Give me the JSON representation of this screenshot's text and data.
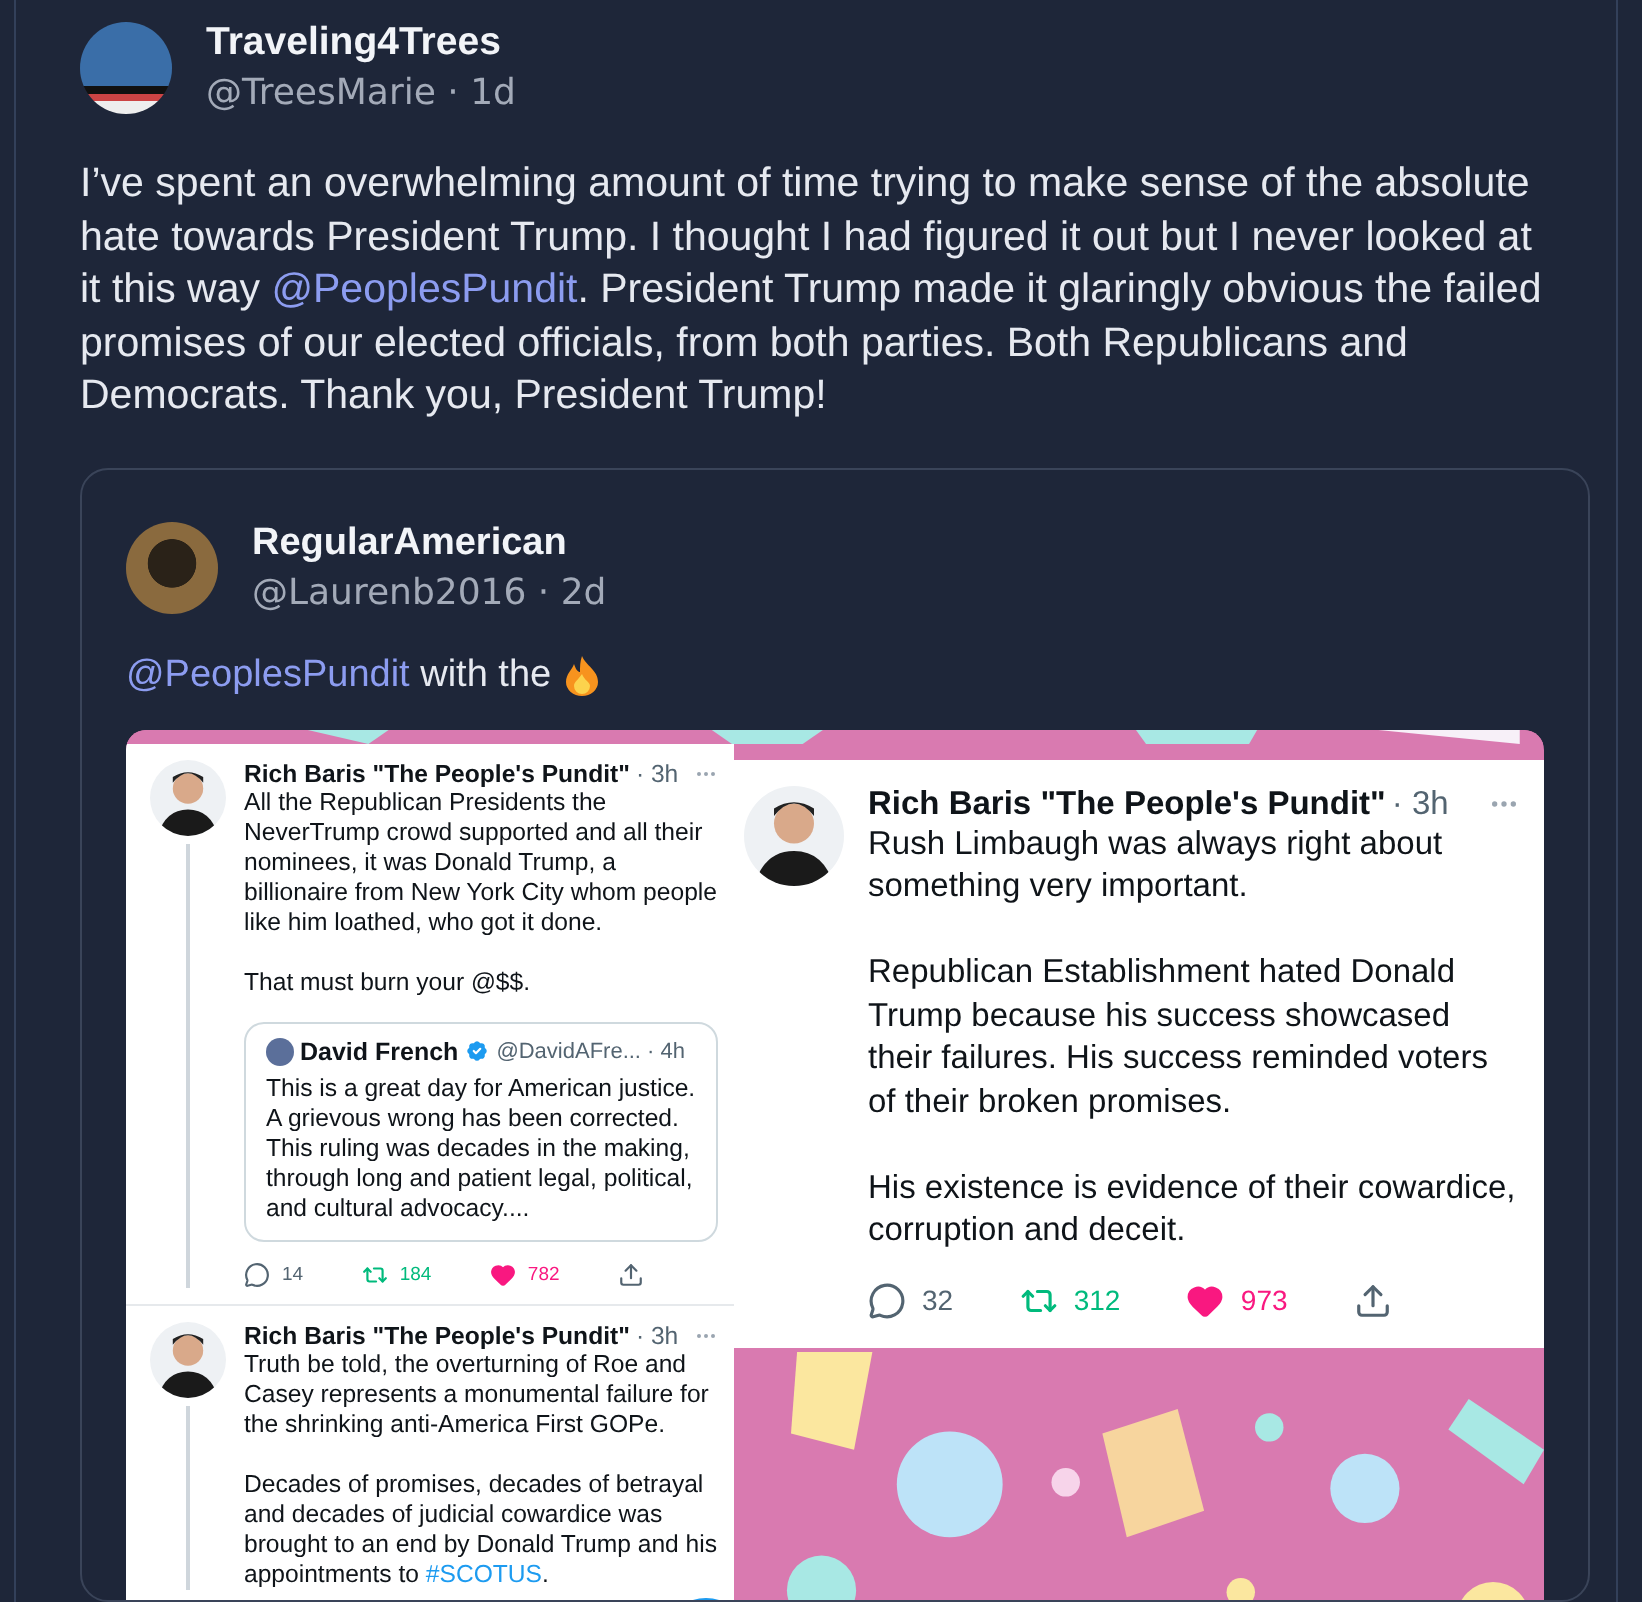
{
  "post": {
    "author": {
      "name": "Traveling4Trees",
      "handle_line": "@TreesMarie · 1d"
    },
    "text": [
      {
        "kind": "text",
        "text": "I’ve spent an overwhelming amount of time trying to make sense of the absolute hate towards President Trump. I thought I had figured it out but I never looked at it this way "
      },
      {
        "kind": "mention",
        "text": "@PeoplesPundit"
      },
      {
        "kind": "text",
        "text": ". President Trump made it glaringly obvious the failed promises of our elected officials, from both parties. Both Republicans and Democrats. Thank you, President Trump!"
      }
    ],
    "quote": {
      "author": {
        "name": "RegularAmerican",
        "handle_line": "@Laurenb2016 · 2d"
      },
      "text": [
        {
          "kind": "mention",
          "text": "@PeoplesPundit"
        },
        {
          "kind": "text",
          "text": " with the"
        }
      ],
      "screenshot": {
        "left": [
          {
            "name": "Rich Baris \"The People's Pundit\"",
            "meta": "· 3h",
            "paragraphs": [
              [
                {
                  "kind": "text",
                  "text": "All the Republican Presidents the NeverTrump crowd supported and all their nominees, it was Donald Trump, a billionaire from New York City whom people like him loathed, who got it done."
                }
              ],
              [
                {
                  "kind": "text",
                  "text": "That must burn your @$$."
                }
              ]
            ],
            "quote": {
              "name": "David French",
              "verified": true,
              "meta": "@DavidAFre... · 4h",
              "text": "This is a great day for American justice. A grievous wrong has been corrected. This ruling was decades in the making, through long and patient legal, political, and cultural advocacy...."
            },
            "stats": {
              "replies": "14",
              "retweets": "184",
              "likes": "782"
            }
          },
          {
            "name": "Rich Baris \"The People's Pundit\"",
            "meta": "· 3h",
            "paragraphs": [
              [
                {
                  "kind": "text",
                  "text": "Truth be told, the overturning of Roe and Casey represents a monumental failure for the shrinking anti-America First GOPe."
                }
              ],
              [
                {
                  "kind": "text",
                  "text": "Decades of promises, decades of betrayal and decades of judicial cowardice was brought to an end by Donald Trump and his appointments to "
                },
                {
                  "kind": "hashtag",
                  "text": "#SCOTUS"
                },
                {
                  "kind": "text",
                  "text": "."
                }
              ]
            ]
          }
        ],
        "right": {
          "name": "Rich Baris \"The People's Pundit\"",
          "meta": "· 3h",
          "paragraphs": [
            [
              {
                "kind": "text",
                "text": "Rush Limbaugh was always right about something very important."
              }
            ],
            [
              {
                "kind": "text",
                "text": "Republican Establishment hated Donald Trump because his success showcased their failures. His success reminded voters of their broken promises."
              }
            ],
            [
              {
                "kind": "text",
                "text": "His existence is evidence of their cowardice, corruption and deceit."
              }
            ]
          ],
          "stats": {
            "replies": "32",
            "retweets": "312",
            "likes": "973"
          }
        }
      }
    }
  }
}
